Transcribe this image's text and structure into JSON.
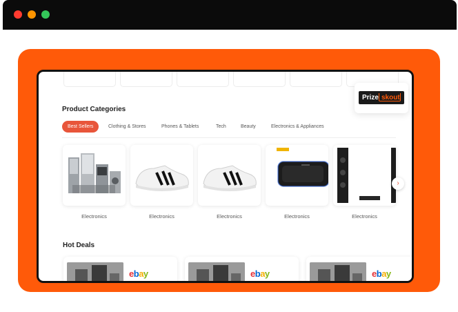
{
  "window": {
    "controls": [
      "close",
      "minimize",
      "maximize"
    ]
  },
  "logo": {
    "part1": "Prize",
    "part2": "skout"
  },
  "categories": {
    "title": "Product Categories",
    "tabs": [
      "Best Sellers",
      "Clothing & Stores",
      "Phones & Tablets",
      "Tech",
      "Beauty",
      "Electronics & Appliances"
    ],
    "active_tab": "Best Sellers",
    "products": [
      {
        "label": "Electronics",
        "image": "kitchen-appliances"
      },
      {
        "label": "Electronics",
        "image": "white-sneaker"
      },
      {
        "label": "Electronics",
        "image": "white-sneaker"
      },
      {
        "label": "Electronics",
        "image": "bluetooth-speaker"
      },
      {
        "label": "Electronics",
        "image": "home-theater-speakers"
      }
    ],
    "next_icon": "›"
  },
  "hot_deals": {
    "title": "Hot Deals",
    "deals": [
      {
        "store": "ebay"
      },
      {
        "store": "ebay"
      },
      {
        "store": "ebay"
      }
    ]
  },
  "colors": {
    "accent": "#ff5a09",
    "tab_active": "#e8553a"
  }
}
